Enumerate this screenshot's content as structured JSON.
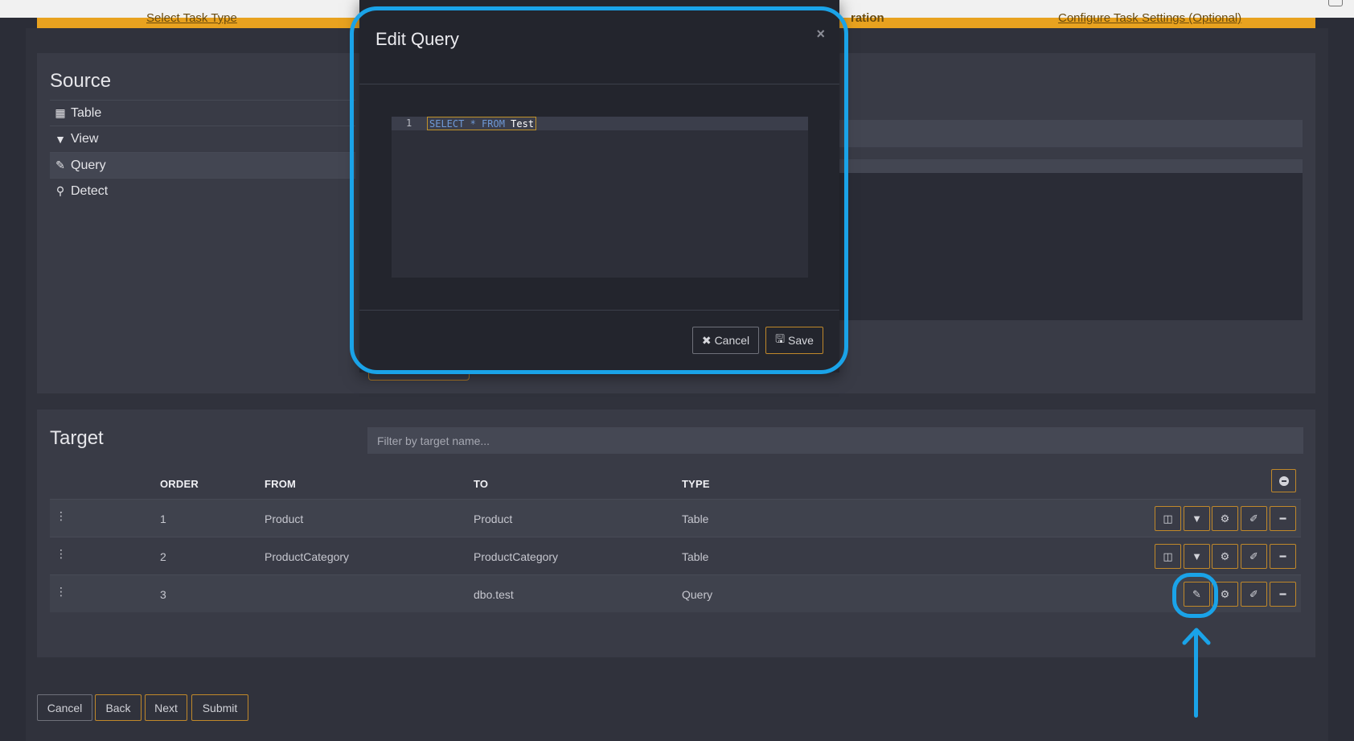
{
  "steps": {
    "select_task_type": "Select Task Type",
    "current_fragment": "ration",
    "configure_settings": "Configure Task Settings (Optional)"
  },
  "source": {
    "title": "Source",
    "items": [
      {
        "label": "Table",
        "icon": "table-icon"
      },
      {
        "label": "View",
        "icon": "filter-icon"
      },
      {
        "label": "Query",
        "icon": "edit-icon"
      },
      {
        "label": "Detect",
        "icon": "search-icon"
      }
    ],
    "active_item": "Query"
  },
  "target": {
    "title": "Target",
    "filter_placeholder": "Filter by target name...",
    "columns": [
      "ORDER",
      "FROM",
      "TO",
      "TYPE"
    ],
    "rows": [
      {
        "order": "1",
        "from": "Product",
        "to": "Product",
        "type": "Table"
      },
      {
        "order": "2",
        "from": "ProductCategory",
        "to": "ProductCategory",
        "type": "Table"
      },
      {
        "order": "3",
        "from": "",
        "to": "dbo.test",
        "type": "Query"
      }
    ]
  },
  "footer": {
    "cancel": "Cancel",
    "back": "Back",
    "next": "Next",
    "submit": "Submit"
  },
  "modal": {
    "title": "Edit Query",
    "close": "×",
    "line_number": "1",
    "query_keyword_1": "SELECT * FROM",
    "query_table": "Test",
    "cancel": "Cancel",
    "save": "Save"
  },
  "colors": {
    "accent_orange": "#e8a21f",
    "highlight_blue": "#1aa3e8",
    "background": "#2b2d37"
  }
}
